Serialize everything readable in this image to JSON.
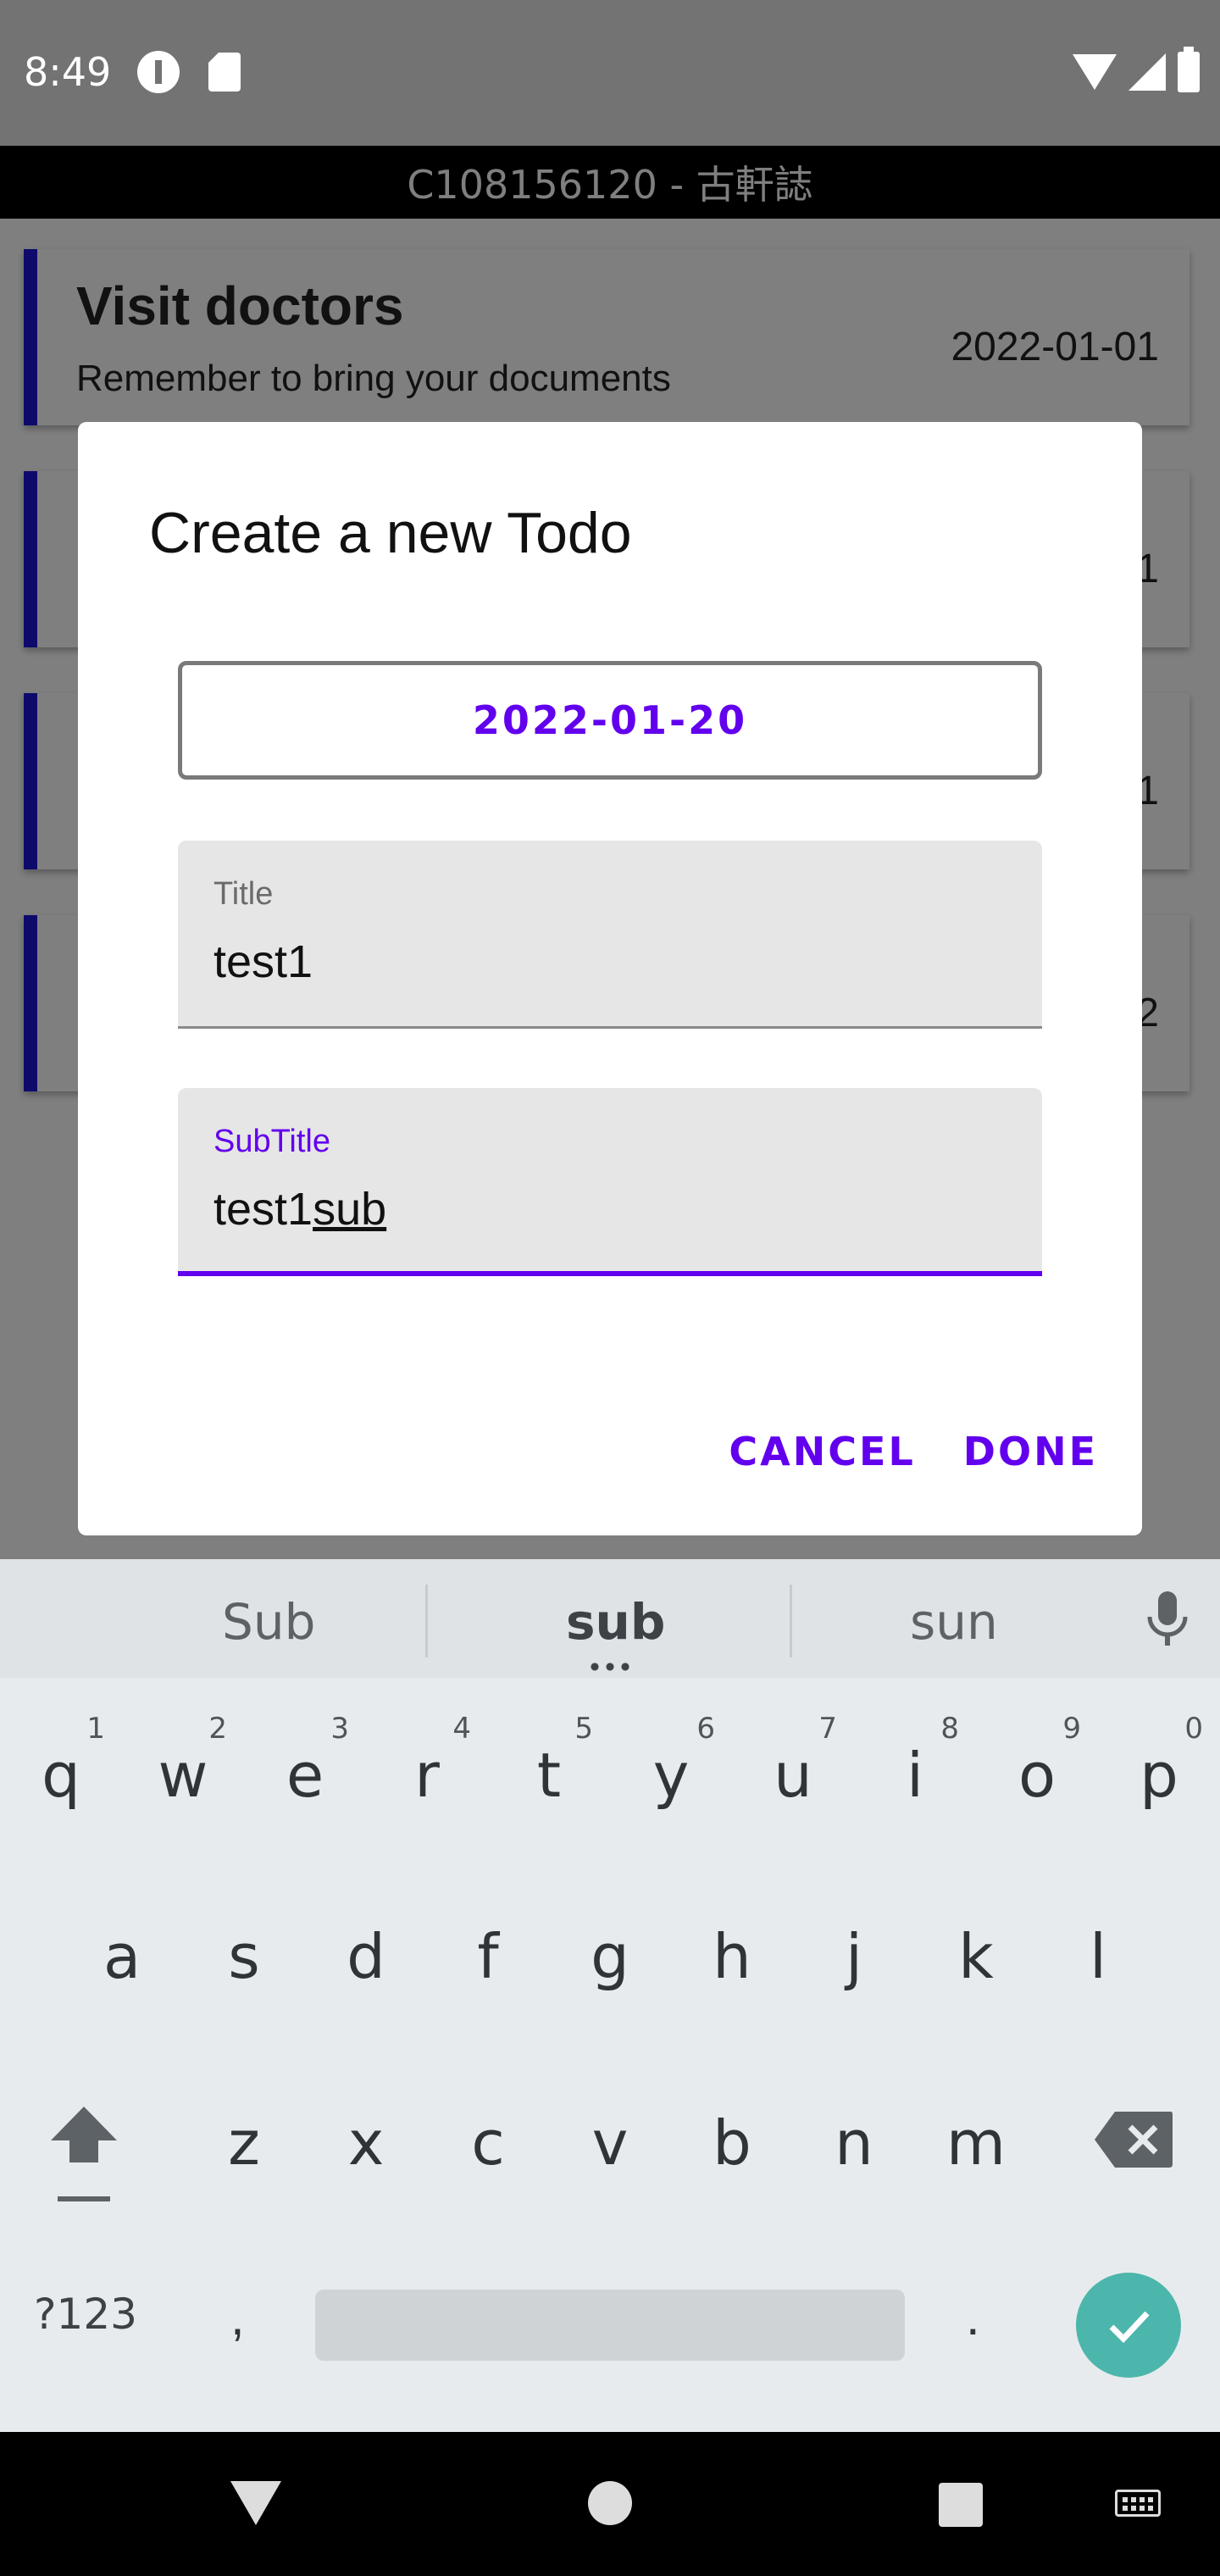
{
  "status_bar": {
    "time": "8:49"
  },
  "app_bar": {
    "title": "C108156120 - 古軒誌"
  },
  "todos": [
    {
      "title": "Visit doctors",
      "subtitle": "Remember to bring your documents",
      "date": "2022-01-01"
    },
    {
      "date_partial": "1"
    },
    {
      "date_partial": "1"
    },
    {
      "date_partial": "2"
    }
  ],
  "dialog": {
    "title": "Create a new Todo",
    "date_button": "2022-01-20",
    "title_field": {
      "label": "Title",
      "value": "test1"
    },
    "subtitle_field": {
      "label": "SubTitle",
      "value_prefix": "test1",
      "value_composing": "sub"
    },
    "cancel_label": "CANCEL",
    "done_label": "DONE"
  },
  "keyboard": {
    "suggestions": [
      "Sub",
      "sub",
      "sun"
    ],
    "row1": [
      {
        "key": "q",
        "hint": "1"
      },
      {
        "key": "w",
        "hint": "2"
      },
      {
        "key": "e",
        "hint": "3"
      },
      {
        "key": "r",
        "hint": "4"
      },
      {
        "key": "t",
        "hint": "5"
      },
      {
        "key": "y",
        "hint": "6"
      },
      {
        "key": "u",
        "hint": "7"
      },
      {
        "key": "i",
        "hint": "8"
      },
      {
        "key": "o",
        "hint": "9"
      },
      {
        "key": "p",
        "hint": "0"
      }
    ],
    "row2": [
      "a",
      "s",
      "d",
      "f",
      "g",
      "h",
      "j",
      "k",
      "l"
    ],
    "row3": [
      "z",
      "x",
      "c",
      "v",
      "b",
      "n",
      "m"
    ],
    "symbols_label": "?123",
    "comma": ",",
    "period": ".",
    "accent_color": "#4db6ac"
  },
  "icons": [
    "shift-icon",
    "backspace-icon",
    "microphone-icon",
    "check-icon",
    "back-icon",
    "home-icon",
    "recents-icon",
    "keyboard-icon"
  ],
  "colors": {
    "primary": "#6200ee",
    "todo_bar": "#1a14d8",
    "app_bar": "#000000"
  }
}
